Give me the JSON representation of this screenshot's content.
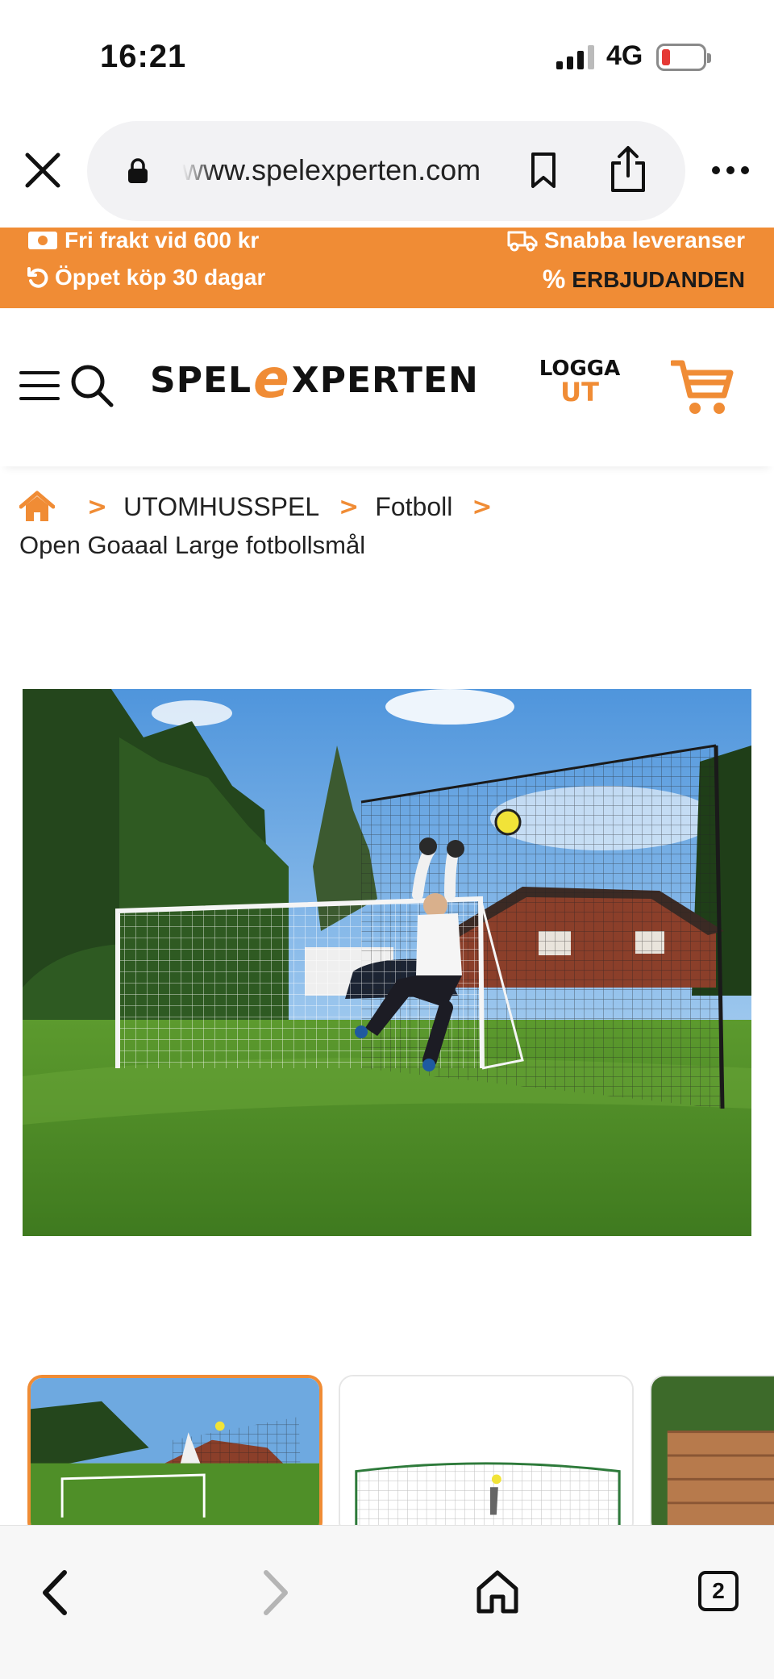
{
  "status_bar": {
    "time": "16:21",
    "network": "4G"
  },
  "browser": {
    "url": "www.spelexperten.com",
    "icons": [
      "close-icon",
      "lock-icon",
      "bookmark-icon",
      "share-icon",
      "more-icon"
    ]
  },
  "promo": {
    "free_shipping": "Fri frakt vid 600 kr",
    "fast_delivery": "Snabba leveranser",
    "open_purchase": "Öppet köp 30 dagar",
    "offers": "ERBJUDANDEN"
  },
  "header": {
    "logo_part1": "SPEL",
    "logo_e": "e",
    "logo_part2": "XPERTEN",
    "logout_line1": "LOGGA",
    "logout_line2": "UT"
  },
  "breadcrumb": {
    "items": [
      "UTOMHUSSPEL",
      "Fotboll"
    ],
    "current": "Open Goaaal Large fotbollsmål"
  },
  "toolbar": {
    "tab_count": "2"
  },
  "colors": {
    "accent": "#f08c35"
  }
}
